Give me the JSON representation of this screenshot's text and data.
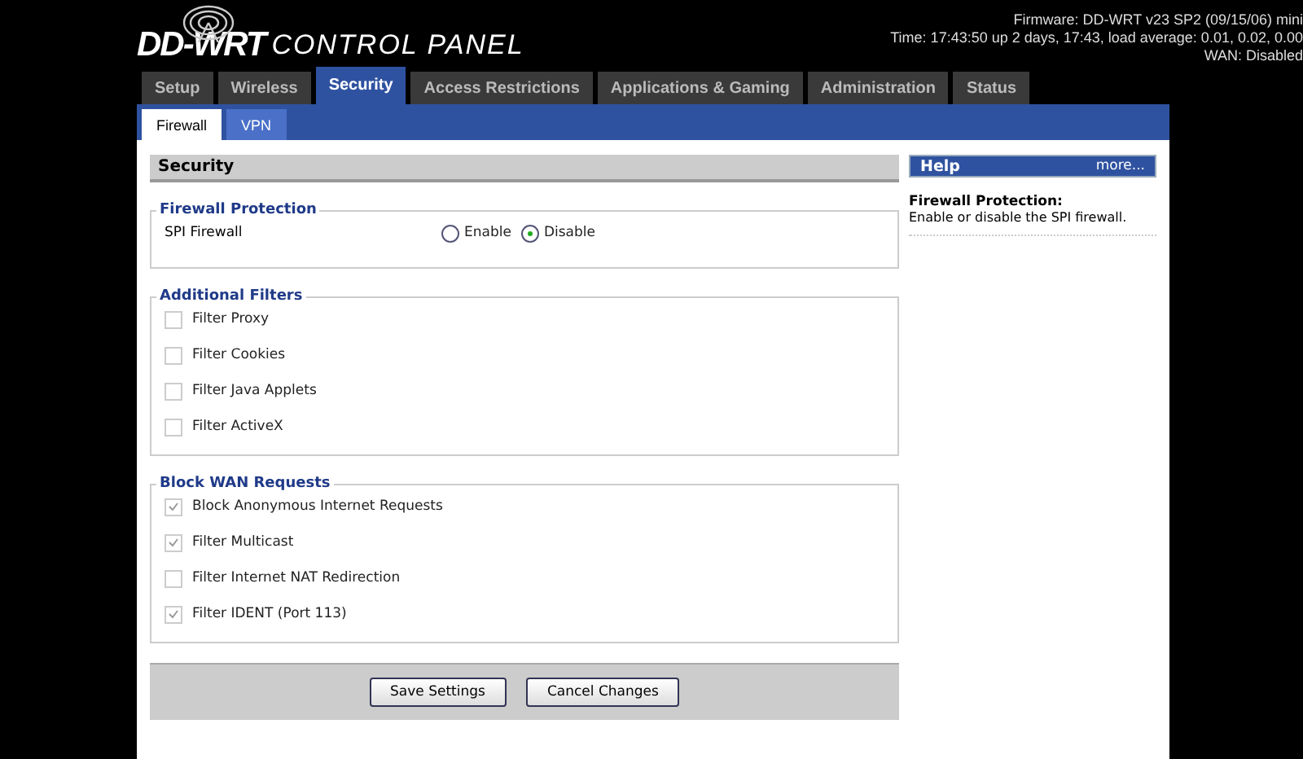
{
  "logo": {
    "brand": "DD-WRT",
    "subtitle": "CONTROL PANEL"
  },
  "status": [
    "Firmware: DD-WRT v23 SP2 (09/15/06) mini",
    "Time: 17:43:50 up 2 days, 17:43, load average: 0.01, 0.02, 0.00",
    "WAN: Disabled"
  ],
  "tabs": [
    {
      "label": "Setup",
      "selected": false
    },
    {
      "label": "Wireless",
      "selected": false
    },
    {
      "label": "Security",
      "selected": true
    },
    {
      "label": "Access Restrictions",
      "selected": false
    },
    {
      "label": "Applications & Gaming",
      "selected": false
    },
    {
      "label": "Administration",
      "selected": false
    },
    {
      "label": "Status",
      "selected": false
    }
  ],
  "subtabs": [
    {
      "label": "Firewall",
      "selected": true
    },
    {
      "label": "VPN",
      "selected": false
    }
  ],
  "section_title": "Security",
  "firewall_protection": {
    "legend": "Firewall Protection",
    "label": "SPI Firewall",
    "options": [
      {
        "label": "Enable",
        "selected": false
      },
      {
        "label": "Disable",
        "selected": true
      }
    ]
  },
  "groups": [
    {
      "legend": "Additional Filters",
      "items": [
        {
          "label": "Filter Proxy",
          "checked": false
        },
        {
          "label": "Filter Cookies",
          "checked": false
        },
        {
          "label": "Filter Java Applets",
          "checked": false
        },
        {
          "label": "Filter ActiveX",
          "checked": false
        }
      ]
    },
    {
      "legend": "Block WAN Requests",
      "items": [
        {
          "label": "Block Anonymous Internet Requests",
          "checked": true
        },
        {
          "label": "Filter Multicast",
          "checked": true
        },
        {
          "label": "Filter Internet NAT Redirection",
          "checked": false
        },
        {
          "label": "Filter IDENT (Port 113)",
          "checked": true
        }
      ]
    }
  ],
  "buttons": [
    "Save Settings",
    "Cancel Changes"
  ],
  "help": {
    "title": "Help",
    "more": "more...",
    "heading": "Firewall Protection:",
    "text": "Enable or disable the SPI firewall."
  }
}
